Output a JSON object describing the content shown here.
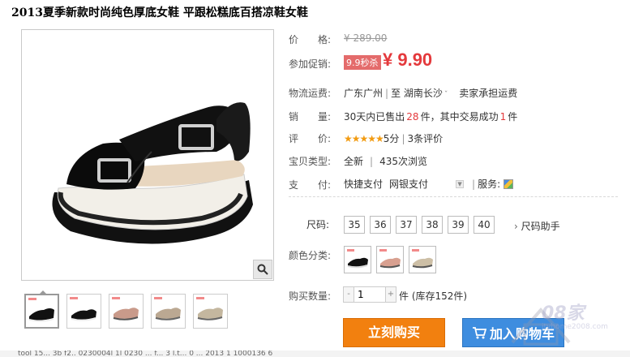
{
  "title": "2013夏季新款时尚纯色厚底女鞋 平跟松糕底百搭凉鞋女鞋",
  "price": {
    "label": "价　　格:",
    "original": "¥ 289.00",
    "promo_label": "参加促销:",
    "promo_badge": "9.9秒杀",
    "promo_price": "¥ 9.90"
  },
  "shipping": {
    "label": "物流运费:",
    "from": "广东广州",
    "to_word": "至",
    "to": "湖南长沙",
    "note": "卖家承担运费"
  },
  "sales": {
    "label": "销　　量:",
    "text_pre": "30天内已售出",
    "count": "28",
    "text_mid": "件，其中交易成功",
    "success": "1",
    "text_post": "件"
  },
  "rating": {
    "label": "评　　价:",
    "stars": "★★★★★",
    "score": "5分",
    "reviews": "3条评价"
  },
  "item_type": {
    "label": "宝贝类型:",
    "condition": "全新",
    "views": "435次浏览"
  },
  "payment": {
    "label": "支　　付:",
    "method1": "快捷支付",
    "method2": "网银支付",
    "service_label": "服务:"
  },
  "size": {
    "label": "尺码:",
    "options": [
      "35",
      "36",
      "37",
      "38",
      "39",
      "40"
    ],
    "help": "尺码助手"
  },
  "color": {
    "label": "颜色分类:"
  },
  "quantity": {
    "label": "购买数量:",
    "value": "1",
    "minus": "-",
    "plus": "+",
    "stock": "件 (库存152件)"
  },
  "buttons": {
    "buy": "立刻购买",
    "cart": "加入购物车"
  },
  "watermark": {
    "text": "08家",
    "url": "ityhome2008.com"
  },
  "url_strip": "tool 15... 3b f2.. 0230004l 1l 0230 ... f... 3 l.t... 0 ... 2013 1 1000136 6"
}
